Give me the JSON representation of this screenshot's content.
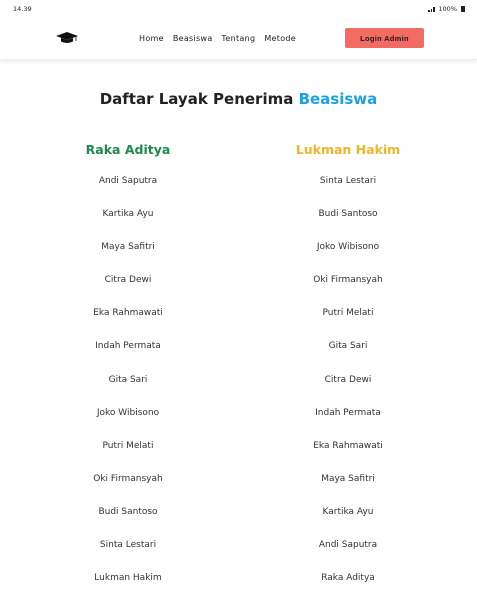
{
  "status_bar": {
    "time": "14.39",
    "battery": "100%"
  },
  "nav": {
    "links": [
      "Home",
      "Beasiswa",
      "Tentang",
      "Metode"
    ],
    "login_label": "Login Admin"
  },
  "page": {
    "title_main": "Daftar Layak Penerima",
    "title_accent": "Beasiswa"
  },
  "columns": [
    {
      "heading": "Raka Aditya",
      "names": [
        "Andi Saputra",
        "Kartika Ayu",
        "Maya Safitri",
        "Citra Dewi",
        "Eka Rahmawati",
        "Indah Permata",
        "Gita Sari",
        "Joko Wibisono",
        "Putri Melati",
        "Oki Firmansyah",
        "Budi Santoso",
        "Sinta Lestari",
        "Lukman Hakim"
      ]
    },
    {
      "heading": "Lukman Hakim",
      "names": [
        "Sinta Lestari",
        "Budi Santoso",
        "Joko Wibisono",
        "Oki Firmansyah",
        "Putri Melati",
        "Gita Sari",
        "Citra Dewi",
        "Indah Permata",
        "Eka Rahmawati",
        "Maya Safitri",
        "Kartika Ayu",
        "Andi Saputra",
        "Raka Aditya"
      ]
    }
  ],
  "colors": {
    "accent_blue": "#1aa1e6",
    "heading_green": "#1e8a4c",
    "heading_yellow": "#f2b52a",
    "login_button": "#f36c63"
  },
  "icons": {
    "logo": "graduation-cap-icon"
  }
}
